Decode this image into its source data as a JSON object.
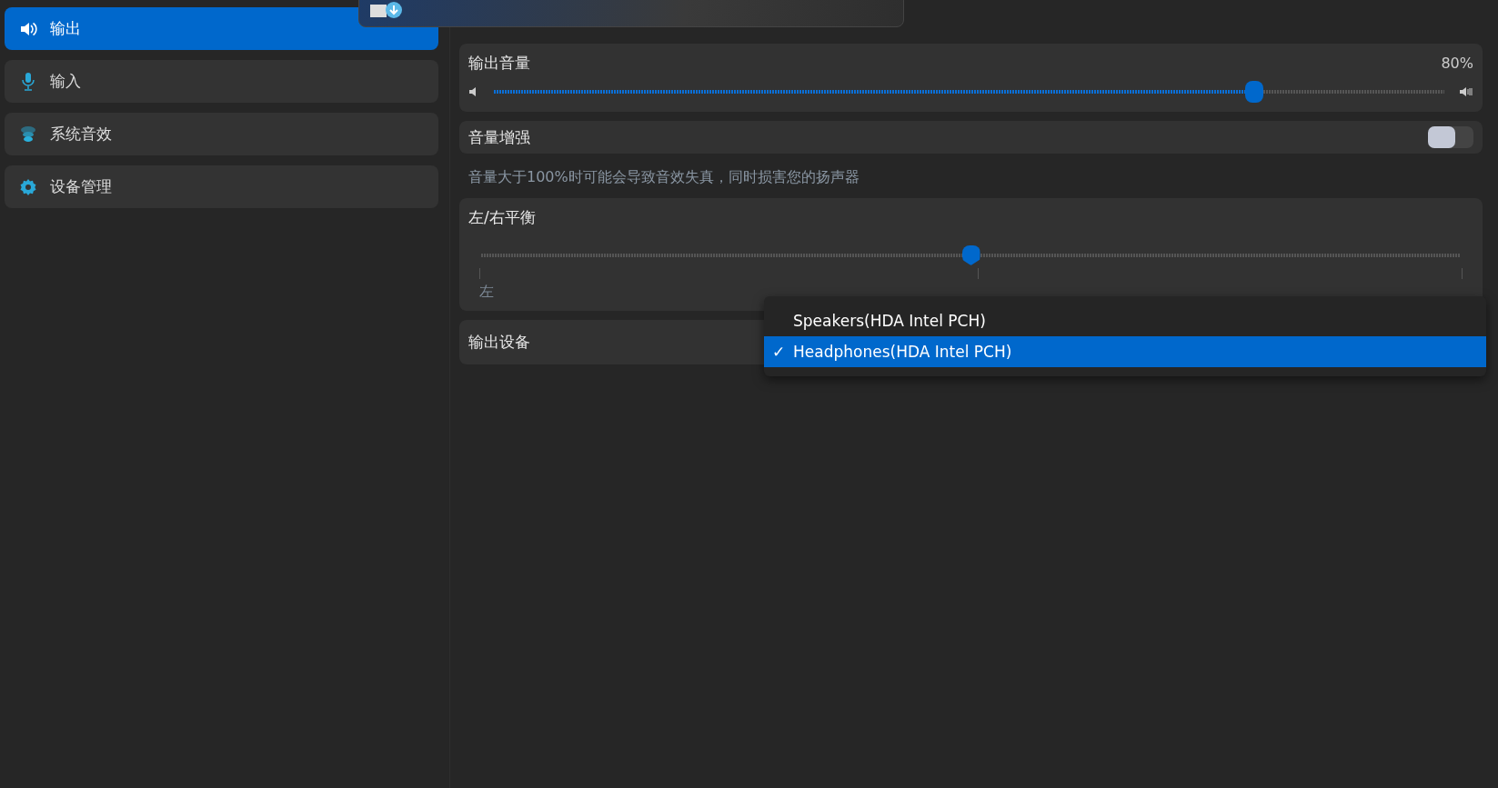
{
  "sidebar": {
    "items": [
      {
        "label": "输出",
        "selected": true
      },
      {
        "label": "输入",
        "selected": false
      },
      {
        "label": "系统音效",
        "selected": false
      },
      {
        "label": "设备管理",
        "selected": false
      }
    ]
  },
  "volume": {
    "label": "输出音量",
    "reading": "80%",
    "level": 0.8
  },
  "boost": {
    "label": "音量增强",
    "on": false,
    "hint": "音量大于100%时可能会导致音效失真，同时损害您的扬声器"
  },
  "balance": {
    "label": "左/右平衡",
    "level": 0.5,
    "left": "左"
  },
  "output_device": {
    "label": "输出设备",
    "options": [
      {
        "label": "Speakers(HDA Intel PCH)",
        "selected": false
      },
      {
        "label": "Headphones(HDA Intel PCH)",
        "selected": true
      }
    ]
  },
  "check_mark": "✓"
}
